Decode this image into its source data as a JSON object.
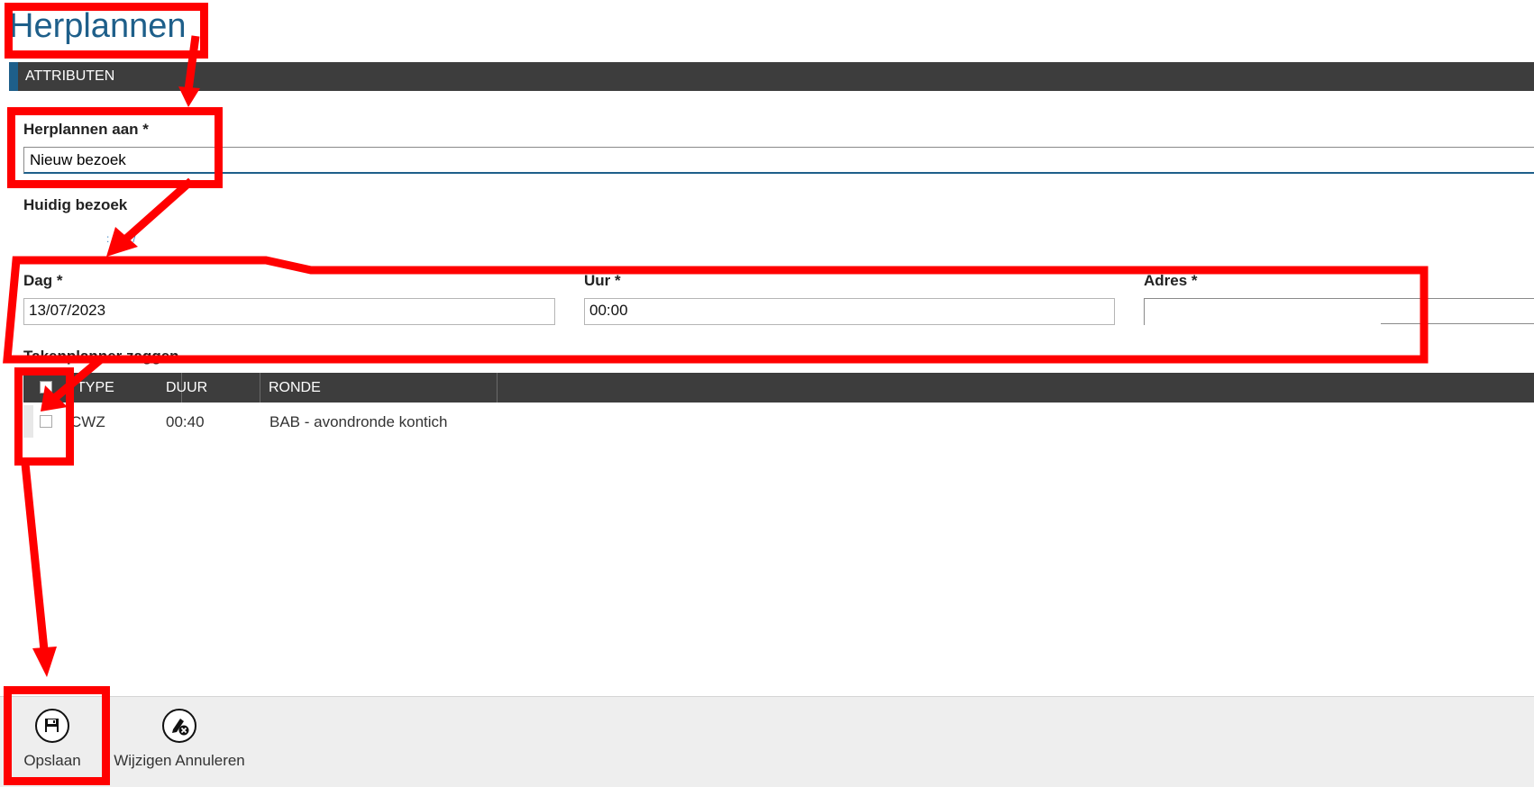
{
  "page": {
    "title": "Herplannen"
  },
  "section": {
    "title": "ATTRIBUTEN"
  },
  "form": {
    "herplannen_label": "Herplannen aan *",
    "herplannen_value": "Nieuw bezoek",
    "huidig_label": "Huidig bezoek",
    "huidig_link": ":  ,  /",
    "dag_label": "Dag *",
    "dag_value": "13/07/2023",
    "uur_label": "Uur *",
    "uur_value": "00:00",
    "adres_label": "Adres *",
    "adres_value": "",
    "taken_label": "Takenplanner zaggen"
  },
  "table": {
    "columns": [
      "TYPE",
      "DUUR",
      "RONDE"
    ],
    "rows": [
      {
        "type": "CWZ",
        "duur": "00:40",
        "ronde": "BAB - avondronde kontich"
      }
    ]
  },
  "toolbar": {
    "save_label": "Opslaan",
    "cancel_label": "Wijzigen Annuleren",
    "save_icon": "floppy-disk-icon",
    "cancel_icon": "edit-cancel-icon"
  },
  "colors": {
    "accent": "#1e5f8a",
    "header_bg": "#3d3d3d",
    "annotation": "#ff0000",
    "toolbar_bg": "#eeeeee"
  }
}
